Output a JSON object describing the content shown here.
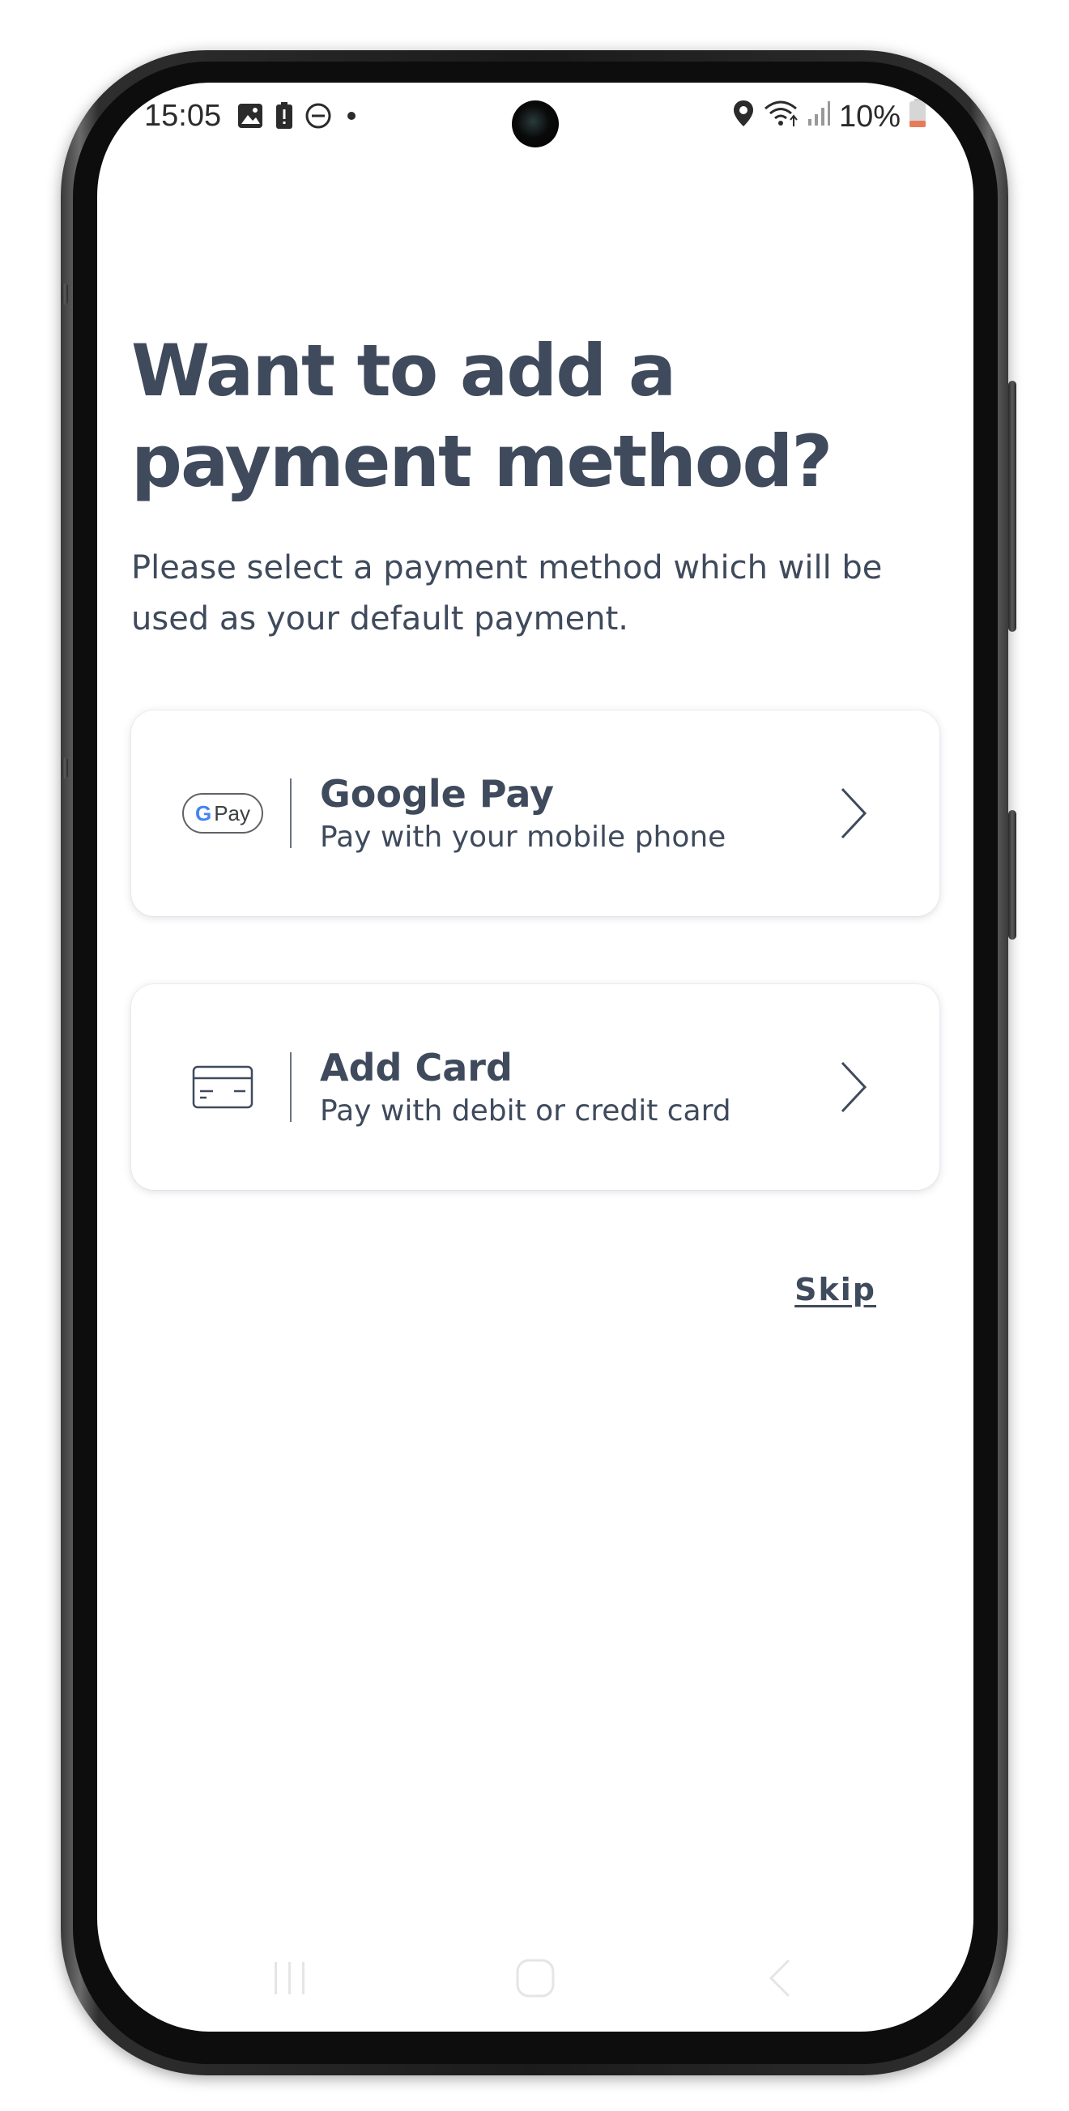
{
  "status_bar": {
    "time": "15:05",
    "battery": "10%",
    "icons": [
      "image-icon",
      "battery-alert-icon",
      "do-not-disturb-icon",
      "dot-icon",
      "location-icon",
      "wifi-icon",
      "signal-icon",
      "battery-icon"
    ],
    "battery_color": "#e87b5a"
  },
  "page": {
    "title_line1": "Want to add a",
    "title_line2": "payment method?",
    "subtitle_line1": "Please select a payment method which will be",
    "subtitle_line2": "used as your default payment."
  },
  "options": [
    {
      "title": "Google Pay",
      "description": "Pay with your mobile phone",
      "icon": "google-pay-icon",
      "icon_g": "G",
      "icon_text": "Pay"
    },
    {
      "title": "Add Card",
      "description": "Pay with debit or credit card",
      "icon": "credit-card-icon"
    }
  ],
  "skip_label": "Skip",
  "nav": {
    "icons": [
      "recent-apps-icon",
      "home-icon",
      "back-icon"
    ]
  },
  "colors": {
    "text_primary": "#3f4a5c",
    "background": "#ffffff",
    "card_background": "#ffffff",
    "google_blue": "#4285f4"
  }
}
